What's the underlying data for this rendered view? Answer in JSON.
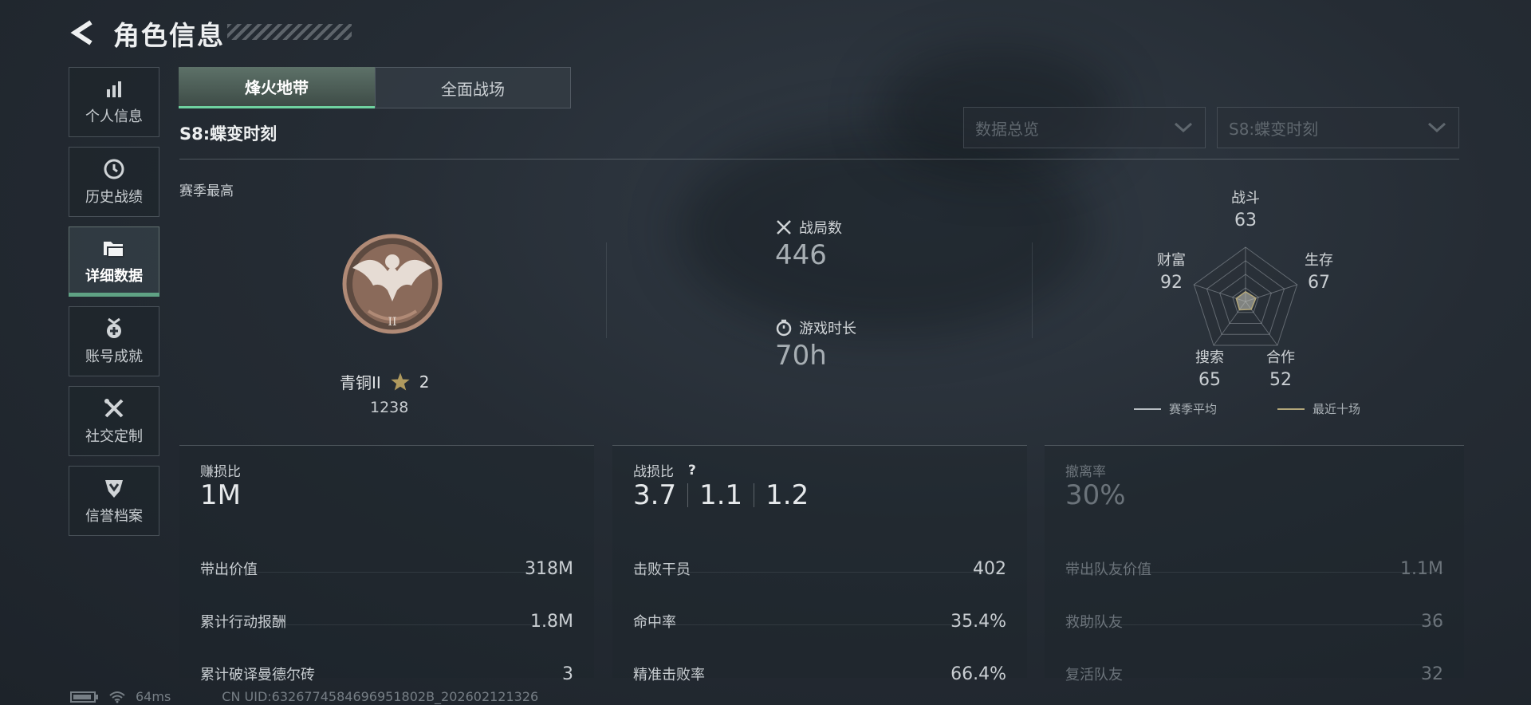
{
  "header": {
    "title": "角色信息"
  },
  "sidebar": {
    "items": [
      {
        "label": "个人信息",
        "icon": "bar-chart-icon"
      },
      {
        "label": "历史战绩",
        "icon": "history-clock-icon"
      },
      {
        "label": "详细数据",
        "icon": "folder-data-icon",
        "active": true
      },
      {
        "label": "账号成就",
        "icon": "achievement-medal-icon"
      },
      {
        "label": "社交定制",
        "icon": "tools-icon"
      },
      {
        "label": "信誉档案",
        "icon": "shield-badge-icon"
      }
    ]
  },
  "mode_tabs": [
    {
      "label": "烽火地带",
      "active": true
    },
    {
      "label": "全面战场",
      "active": false
    }
  ],
  "season_title": "S8:蝶变时刻",
  "dropdowns": [
    {
      "value": "数据总览"
    },
    {
      "value": "S8:蝶变时刻"
    }
  ],
  "rank": {
    "section_label": "赛季最高",
    "name": "青铜II",
    "stars": "2",
    "score": "1238",
    "badge_numeral": "II"
  },
  "summary": {
    "matches": {
      "label": "战局数",
      "value": "446"
    },
    "playtime": {
      "label": "游戏时长",
      "value": "70h"
    }
  },
  "radar": {
    "axes": [
      {
        "label": "战斗",
        "value": 63
      },
      {
        "label": "生存",
        "value": 67
      },
      {
        "label": "合作",
        "value": 52
      },
      {
        "label": "搜索",
        "value": 65
      },
      {
        "label": "财富",
        "value": 92
      }
    ],
    "season_average_shape": [
      0.18,
      0.2,
      0.18,
      0.19,
      0.18
    ],
    "legend": [
      {
        "label": "赛季平均",
        "color": "#b8bec3"
      },
      {
        "label": "最近十场",
        "color": "#b3a77a"
      }
    ]
  },
  "panels": {
    "profit": {
      "label": "赚损比",
      "value": "1M",
      "rows": [
        {
          "label": "带出价值",
          "value": "318M"
        },
        {
          "label": "累计行动报酬",
          "value": "1.8M"
        },
        {
          "label": "累计破译曼德尔砖",
          "value": "3"
        }
      ]
    },
    "kd": {
      "label": "战损比",
      "help": "?",
      "values": [
        "3.7",
        "1.1",
        "1.2"
      ],
      "rows": [
        {
          "label": "击败干员",
          "value": "402"
        },
        {
          "label": "命中率",
          "value": "35.4%"
        },
        {
          "label": "精准击败率",
          "value": "66.4%"
        }
      ]
    },
    "extract": {
      "label": "撤离率",
      "value": "30%",
      "rows": [
        {
          "label": "带出队友价值",
          "value": "1.1M"
        },
        {
          "label": "救助队友",
          "value": "36"
        },
        {
          "label": "复活队友",
          "value": "32"
        }
      ]
    }
  },
  "footer": {
    "ping": "64ms",
    "uid": "CN UID:6326774584696951802B_202602121326"
  },
  "colors": {
    "accent_green": "#6fd2a0",
    "badge_bronze": "#8a6a5a"
  }
}
